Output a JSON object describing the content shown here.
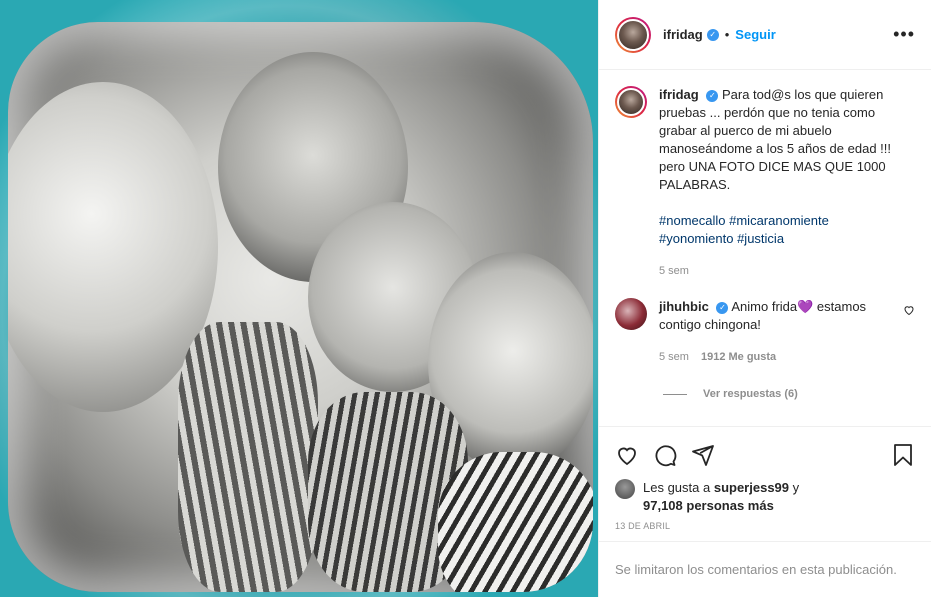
{
  "post": {
    "author": "ifridag",
    "follow_label": "Seguir",
    "dot_separator": "•",
    "more_label": "•••"
  },
  "caption": {
    "username": "ifridag",
    "text": "Para tod@s los que quieren pruebas ... perdón que no tenia como grabar al puerco de mi abuelo manoseándome a los 5 años de edad !!! pero UNA FOTO DICE MAS QUE 1000 PALABRAS.",
    "hashtags_line1": [
      "#nomecallo",
      "#micaranomiente"
    ],
    "hashtags_line2": [
      "#yonomiento",
      "#justicia"
    ],
    "time": "5 sem"
  },
  "comments": [
    {
      "username": "jihuhbic",
      "text": "Animo frida💜 estamos contigo chingona!",
      "time": "5 sem",
      "likes": "1912 Me gusta",
      "replies_label": "Ver respuestas (6)"
    }
  ],
  "likes": {
    "prefix": "Les gusta a",
    "user": "superjess99",
    "connector": "y",
    "count": "97,108 personas más"
  },
  "date": "13 DE ABRIL",
  "comments_disabled": "Se limitaron los comentarios en esta publicación.",
  "icons": [
    "heart-icon",
    "comment-icon",
    "share-icon",
    "bookmark-icon"
  ],
  "colors": {
    "link": "#0095f6",
    "hashtag": "#00376b",
    "muted": "#8e8e8e",
    "media_bg": "#2aa8b3"
  }
}
